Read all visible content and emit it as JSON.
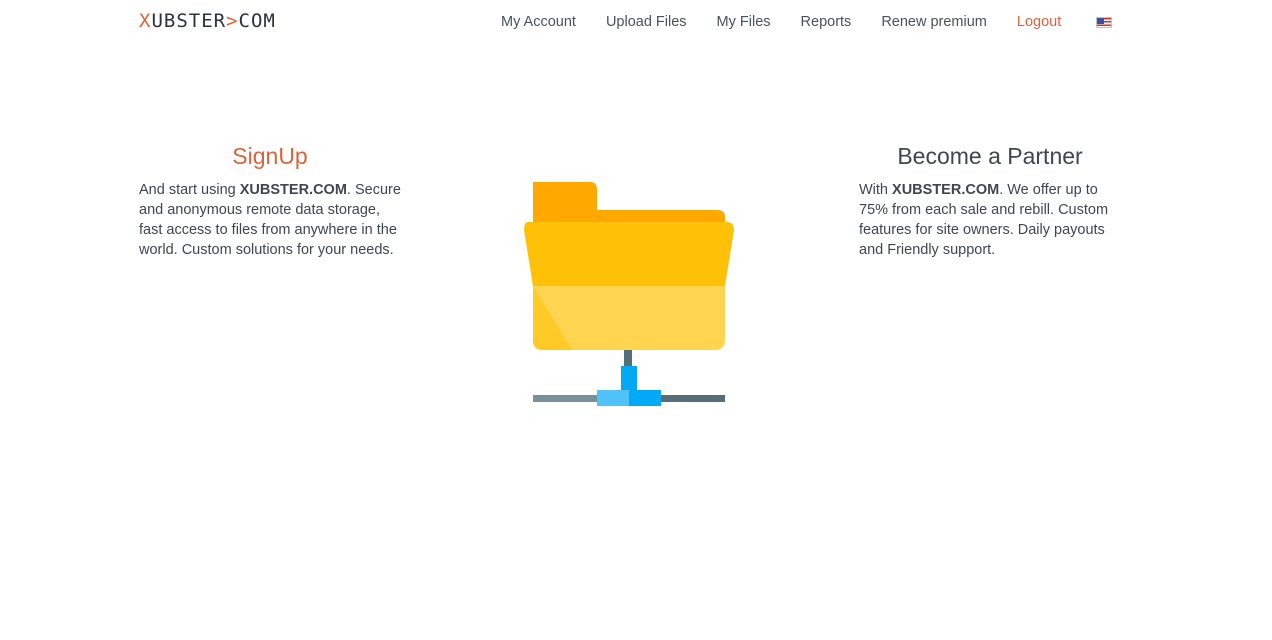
{
  "header": {
    "logo": {
      "prefix": "X",
      "middle": "UBSTER",
      "dot": ">",
      "suffix": "COM"
    },
    "nav": [
      {
        "label": "My Account"
      },
      {
        "label": "Upload Files"
      },
      {
        "label": "My Files"
      },
      {
        "label": "Reports"
      },
      {
        "label": "Renew premium"
      },
      {
        "label": "Logout"
      }
    ],
    "language_icon": "us-flag-icon"
  },
  "signup": {
    "title": "SignUp",
    "text_before": "And start using ",
    "brand": "XUBSTER.COM",
    "text_after": ". Secure and anonymous remote data storage, fast access to files from anywhere in the world. Custom solutions for your needs."
  },
  "partner": {
    "title": "Become a Partner",
    "text_before": "With ",
    "brand": "XUBSTER.COM",
    "text_after": ". We offer up to 75% from each sale and rebill. Custom features for site owners. Daily payouts and Friendly support."
  },
  "illustration": {
    "icon": "network-folder-icon"
  },
  "colors": {
    "accent": "#d9643f",
    "text": "#3f4650",
    "folder_back": "#ffa800",
    "folder_front": "#ffc107",
    "folder_light": "#ffd54f",
    "network_blue": "#03a9f4",
    "network_gray": "#607d8b"
  }
}
